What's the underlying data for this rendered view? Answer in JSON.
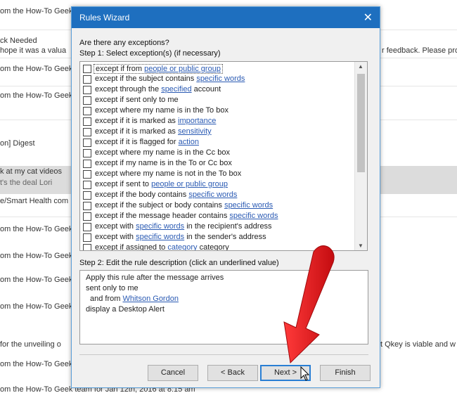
{
  "background": {
    "rows": [
      "om the How-To Geek",
      "ck Needed",
      "hope it was a valua",
      "om the How-To Geek",
      "om the How-To Geek",
      "on] Digest",
      "k at my cat videos",
      "t's the deal Lori",
      "e/Smart Health com",
      "om the How-To Geek",
      "om the How-To Geek",
      "om the How-To Geek",
      "om the How-To Geek",
      "for the unveiling o",
      "om the How-To Geek",
      "om the How-To Geek team for Jan 12th, 2016 at 8:15 am"
    ],
    "right_texts": [
      "r feedback. Please pro",
      "t Qkey is viable and w"
    ]
  },
  "dialog": {
    "title": "Rules Wizard",
    "close": "✕",
    "question": "Are there any exceptions?",
    "step1": "Step 1: Select exception(s) (if necessary)",
    "step2": "Step 2: Edit the rule description (click an underlined value)",
    "exceptions": [
      {
        "pre": "except if from ",
        "link": "people or public group",
        "post": ""
      },
      {
        "pre": "except if the subject contains ",
        "link": "specific words",
        "post": ""
      },
      {
        "pre": "except through the ",
        "link": "specified",
        "post": " account"
      },
      {
        "pre": "except if sent only to me",
        "link": "",
        "post": ""
      },
      {
        "pre": "except where my name is in the To box",
        "link": "",
        "post": ""
      },
      {
        "pre": "except if it is marked as ",
        "link": "importance",
        "post": ""
      },
      {
        "pre": "except if it is marked as ",
        "link": "sensitivity",
        "post": ""
      },
      {
        "pre": "except if it is flagged for ",
        "link": "action",
        "post": ""
      },
      {
        "pre": "except where my name is in the Cc box",
        "link": "",
        "post": ""
      },
      {
        "pre": "except if my name is in the To or Cc box",
        "link": "",
        "post": ""
      },
      {
        "pre": "except where my name is not in the To box",
        "link": "",
        "post": ""
      },
      {
        "pre": "except if sent to ",
        "link": "people or public group",
        "post": ""
      },
      {
        "pre": "except if the body contains ",
        "link": "specific words",
        "post": ""
      },
      {
        "pre": "except if the subject or body contains ",
        "link": "specific words",
        "post": ""
      },
      {
        "pre": "except if the message header contains ",
        "link": "specific words",
        "post": ""
      },
      {
        "pre": "except with ",
        "link": "specific words",
        "post": " in the recipient's address"
      },
      {
        "pre": "except with ",
        "link": "specific words",
        "post": " in the sender's address"
      },
      {
        "pre": "except if assigned to ",
        "link": "category",
        "post": " category"
      }
    ],
    "description": {
      "line1": "Apply this rule after the message arrives",
      "line2": "sent only to me",
      "line3_pre": "and from ",
      "line3_link": "Whitson Gordon",
      "line4": "display a Desktop Alert"
    },
    "buttons": {
      "cancel": "Cancel",
      "back": "< Back",
      "next": "Next >",
      "finish": "Finish"
    }
  },
  "colors": {
    "titlebar": "#1e6fbf",
    "link": "#2a5ab3",
    "arrow": "#e8161c"
  }
}
